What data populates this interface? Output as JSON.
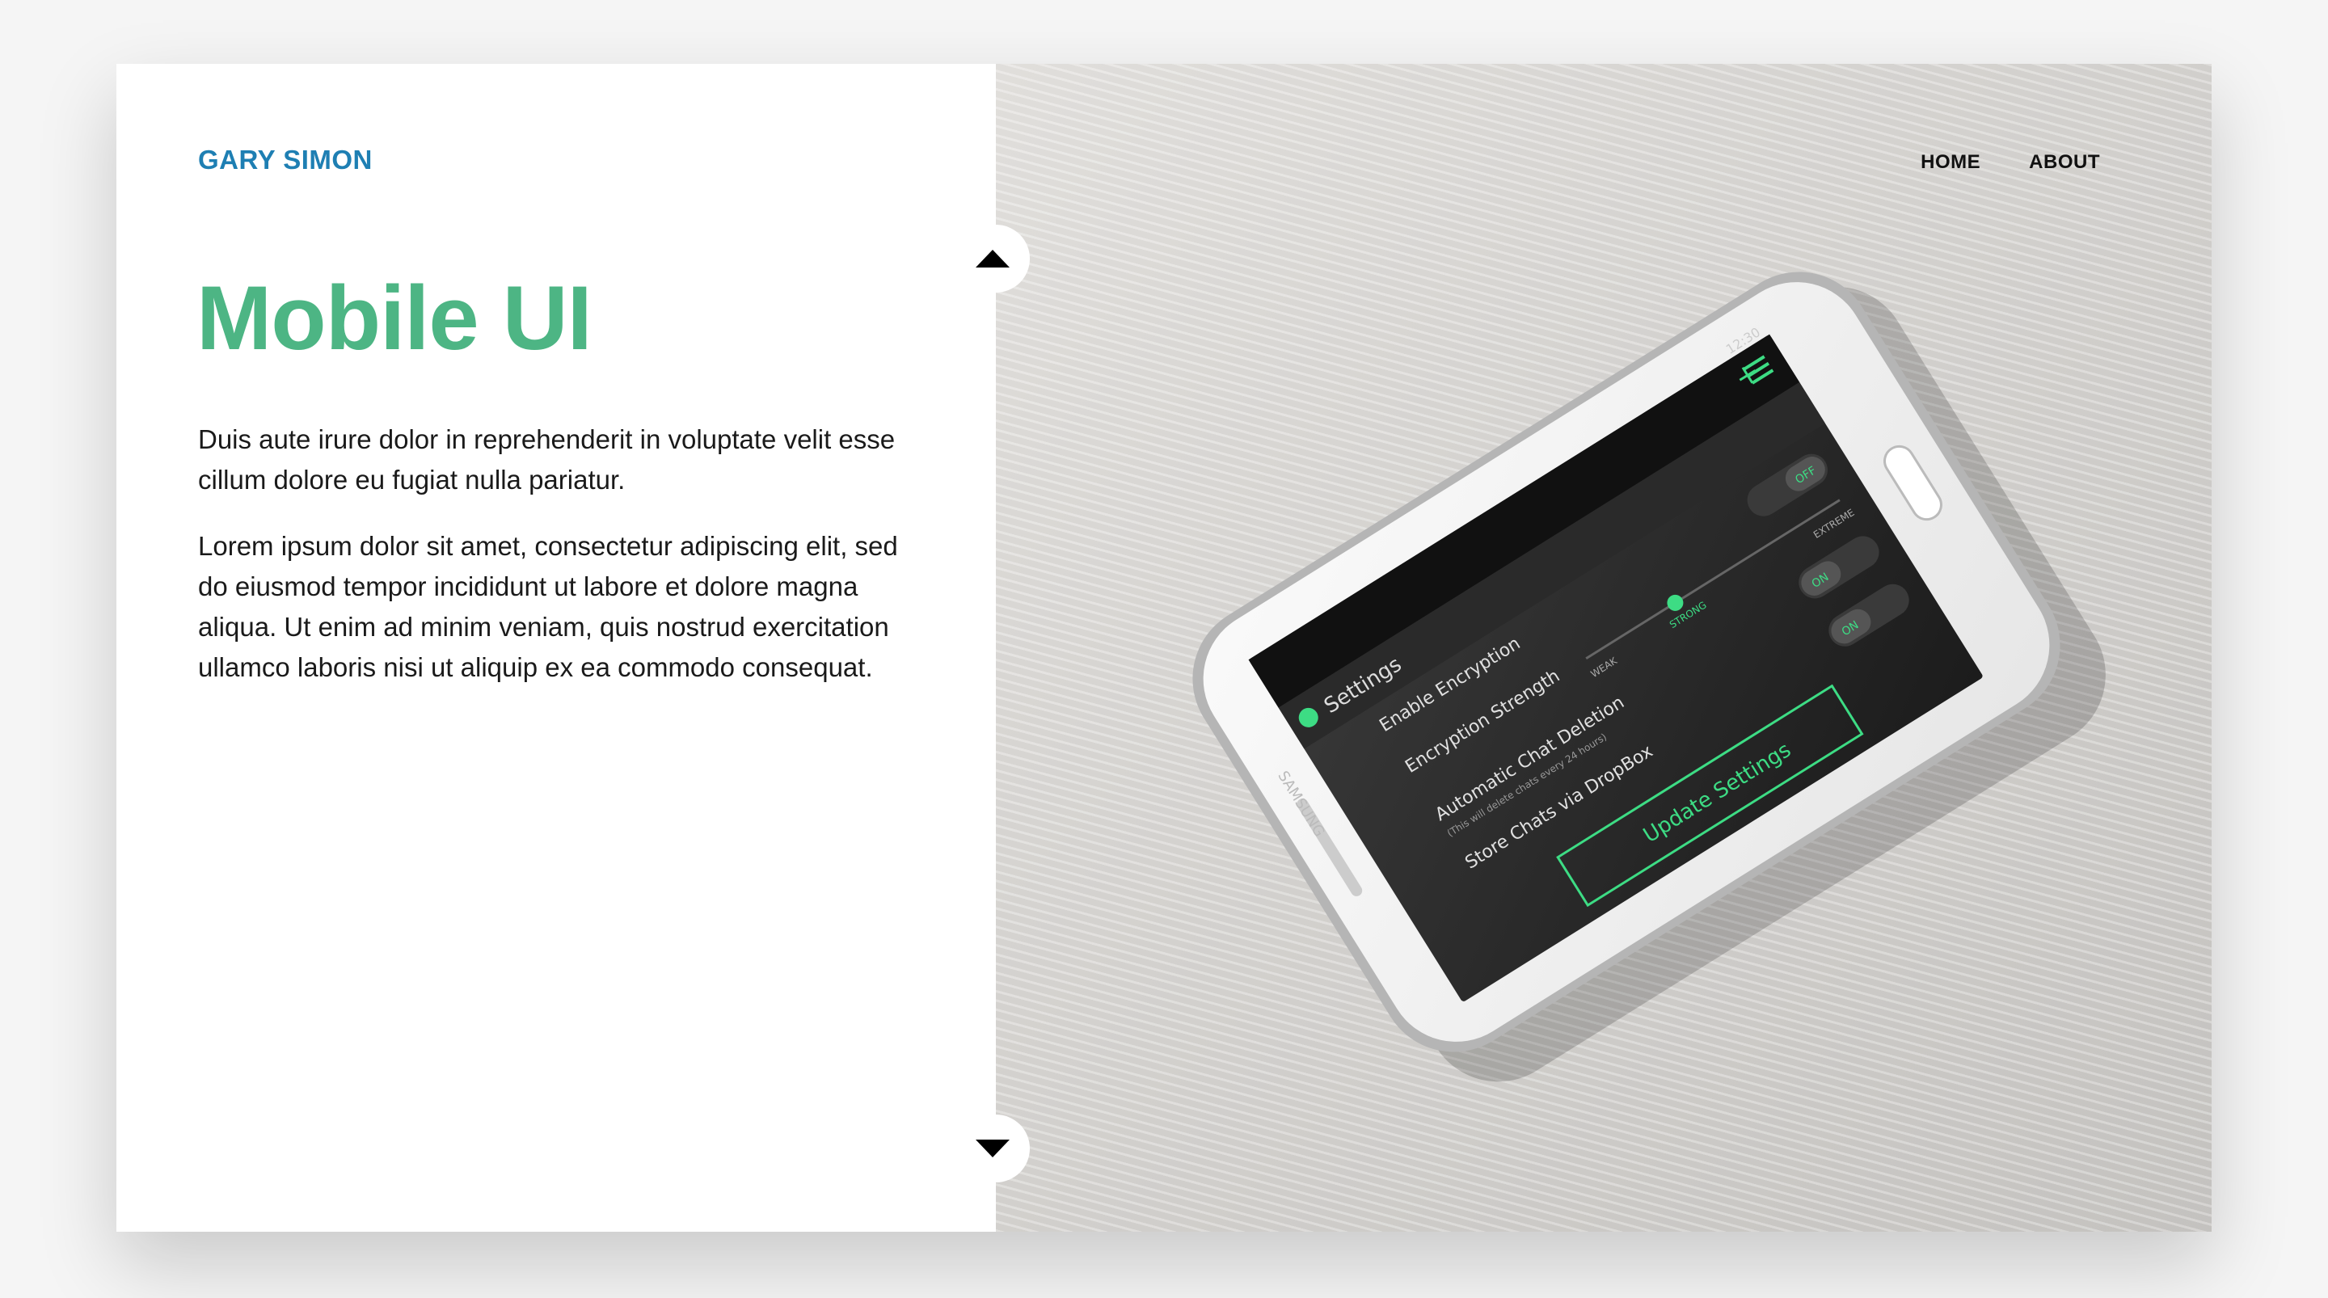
{
  "brand": {
    "name": "GARY SIMON"
  },
  "nav": {
    "home": "HOME",
    "about": "ABOUT"
  },
  "hero": {
    "title": "Mobile UI",
    "paragraph_1": "Duis aute irure dolor in reprehenderit in voluptate velit esse cillum dolore eu fugiat nulla pariatur.",
    "paragraph_2": "Lorem ipsum dolor sit amet, consectetur adipiscing elit, sed do eiusmod tempor incididunt ut labore et dolore magna aliqua. Ut enim ad minim veniam, quis nostrud exercitation ullamco laboris nisi ut aliquip ex ea commodo consequat."
  },
  "controls": {
    "up_icon": "triangle-up-icon",
    "down_icon": "triangle-down-icon"
  },
  "phone": {
    "brand": "SAMSUNG",
    "time": "12:30",
    "screen_title": "Settings",
    "rows": {
      "encryption": "Enable Encryption",
      "strength": "Encryption Strength",
      "deletion": "Automatic Chat Deletion",
      "deletion_note": "(This will delete chats every 24 hours)",
      "dropbox": "Store Chats via DropBox"
    },
    "slider": {
      "weak": "WEAK",
      "strong": "STRONG",
      "extreme": "EXTREME"
    },
    "toggle_on": "ON",
    "toggle_off": "OFF",
    "update_button": "Update Settings"
  },
  "colors": {
    "brand": "#1e7fb3",
    "title": "#4db584",
    "accent_green": "#3ddc84"
  }
}
